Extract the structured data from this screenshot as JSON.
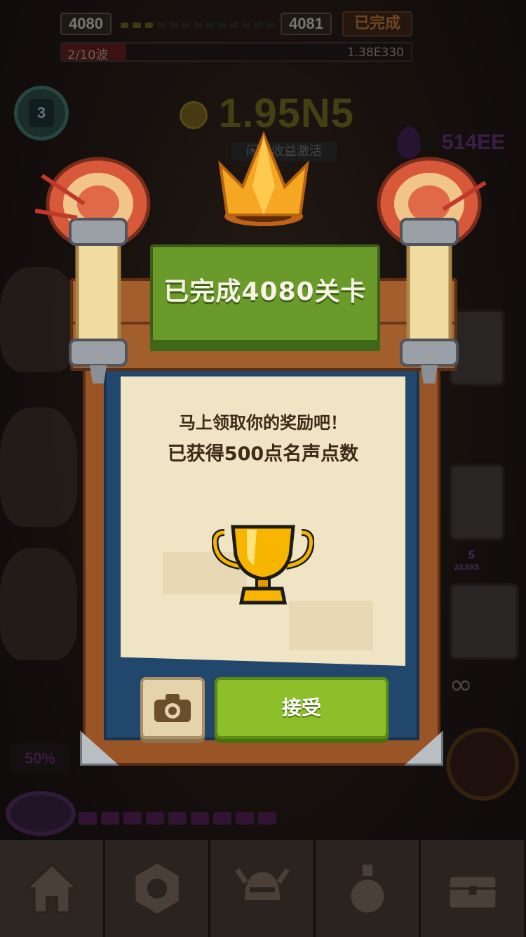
{
  "hud": {
    "current_level": "4080",
    "next_level": "4081",
    "completed_badge": "已完成",
    "wave_label": "2/10波",
    "wave_total": "1.38E330",
    "stage_number": "3",
    "gold_amount": "1.95N5",
    "idle_bonus": "闲置收益激活",
    "gem_amount": "514EE",
    "percent_label": "50%",
    "side_label_1": "5",
    "side_label_2": "23.5X5",
    "infinity_symbol": "∞"
  },
  "modal": {
    "title": "已完成4080关卡",
    "message_line1": "马上领取你的奖励吧！",
    "message_line2": "已获得500点名声点数",
    "accept_button": "接受",
    "camera_icon": "camera-icon",
    "trophy_icon": "trophy-icon",
    "crown_icon": "crown-icon"
  },
  "nav": {
    "items": [
      {
        "icon": "home-icon"
      },
      {
        "icon": "gear-nut-icon"
      },
      {
        "icon": "helmet-icon"
      },
      {
        "icon": "potion-icon"
      },
      {
        "icon": "chest-icon"
      }
    ]
  },
  "colors": {
    "banner_green": "#6a9a2a",
    "accept_green": "#8cbf2a",
    "frame_wood": "#9a5527",
    "panel_blue": "#21476d",
    "paper": "#efe4c3"
  }
}
